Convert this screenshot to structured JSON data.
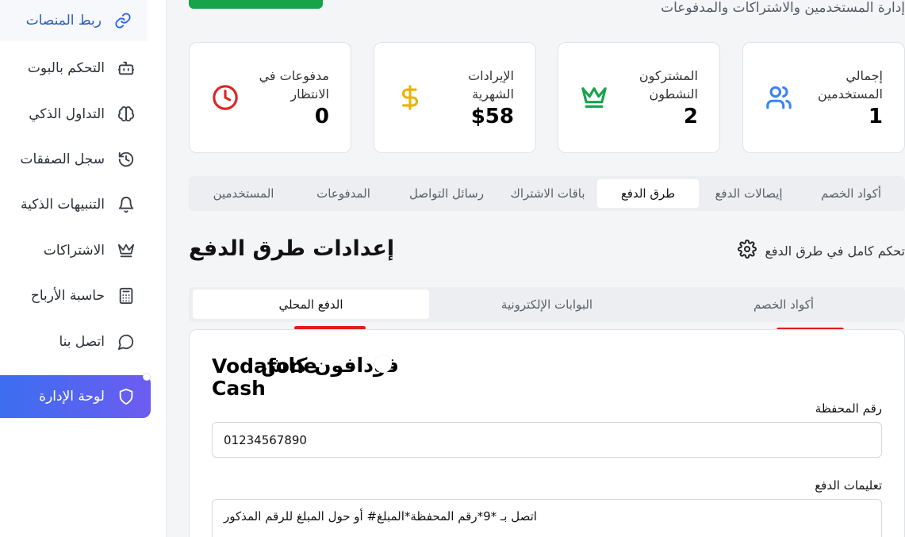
{
  "sidebar": {
    "items": [
      {
        "label": "ربط المنصات",
        "icon": "link-icon"
      },
      {
        "label": "التحكم بالبوت",
        "icon": "bot-icon"
      },
      {
        "label": "التداول الذكي",
        "icon": "brain-icon"
      },
      {
        "label": "سجل الصفقات",
        "icon": "history-icon"
      },
      {
        "label": "التنبيهات الذكية",
        "icon": "bell-icon"
      },
      {
        "label": "الاشتراكات",
        "icon": "crown-icon"
      },
      {
        "label": "حاسبة الأرباح",
        "icon": "calculator-icon"
      },
      {
        "label": "اتصل بنا",
        "icon": "chat-icon"
      },
      {
        "label": "لوحة الإدارة",
        "icon": "shield-icon"
      }
    ]
  },
  "header": {
    "subtitle": "إدارة المستخدمين والاشتراكات والمدفوعات"
  },
  "stats": [
    {
      "label": "إجمالي المستخدمين",
      "value": "1",
      "icon": "users-icon",
      "color": "#3b82f6"
    },
    {
      "label": "المشتركون النشطون",
      "value": "2",
      "icon": "crown-icon",
      "color": "#16a34a"
    },
    {
      "label": "الإيرادات الشهرية",
      "value": "$58",
      "icon": "dollar-icon",
      "color": "#eab308"
    },
    {
      "label": "مدفوعات في الانتظار",
      "value": "0",
      "icon": "clock-icon",
      "color": "#dc2626"
    }
  ],
  "tabs": [
    "أكواد الخصم",
    "إيصالات الدفع",
    "طرق الدفع",
    "باقات الاشتراك",
    "رسائل التواصل",
    "المدفوعات",
    "المستخدمين"
  ],
  "section": {
    "title": "إعدادات طرق الدفع",
    "description": "تحكم كامل في طرق الدفع"
  },
  "subtabs": [
    "أكواد الخصم",
    "البوابات الإلكترونية",
    "الدفع المحلي"
  ],
  "method": {
    "name_en": "Vodafone Cash",
    "name_ar": "فودافون كاش",
    "fields": {
      "wallet_label": "رقم المحفظة",
      "wallet_value": "01234567890",
      "instructions_label": "تعليمات الدفع",
      "instructions_value": "اتصل بـ *9*رقم المحفظة*المبلغ# أو حول المبلغ للرقم المذكور"
    }
  },
  "colors": {
    "accent": "#3b6ef0",
    "underline": "#e11d1d",
    "success": "#16a34a"
  }
}
